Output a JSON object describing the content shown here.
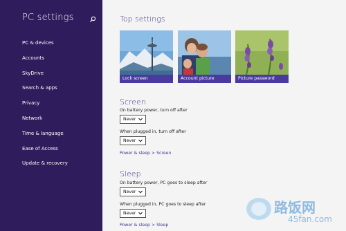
{
  "sidebar": {
    "title": "PC settings",
    "search_icon": "search-icon",
    "items": [
      {
        "label": "PC & devices"
      },
      {
        "label": "Accounts"
      },
      {
        "label": "SkyDrive"
      },
      {
        "label": "Search & apps"
      },
      {
        "label": "Privacy"
      },
      {
        "label": "Network"
      },
      {
        "label": "Time & language"
      },
      {
        "label": "Ease of Access"
      },
      {
        "label": "Update & recovery"
      }
    ]
  },
  "top_settings": {
    "title": "Top settings",
    "tiles": [
      {
        "label": "Lock screen"
      },
      {
        "label": "Account picture"
      },
      {
        "label": "Picture password"
      }
    ]
  },
  "screen": {
    "title": "Screen",
    "battery_label": "On battery power, turn off after",
    "battery_value": "Never",
    "plugged_label": "When plugged in, turn off after",
    "plugged_value": "Never",
    "link": "Power & sleep > Screen"
  },
  "sleep": {
    "title": "Sleep",
    "battery_label": "On battery power, PC goes to sleep after",
    "battery_value": "Never",
    "plugged_label": "When plugged in, PC goes to sleep after",
    "plugged_value": "Never",
    "link": "Power & sleep > Sleep"
  },
  "watermark": {
    "text_cn": "路饭网",
    "url": "45fan.com"
  },
  "colors": {
    "sidebar_bg": "#2e1c5c",
    "accent": "#4a3aa0",
    "title_text": "#3c2c80"
  }
}
